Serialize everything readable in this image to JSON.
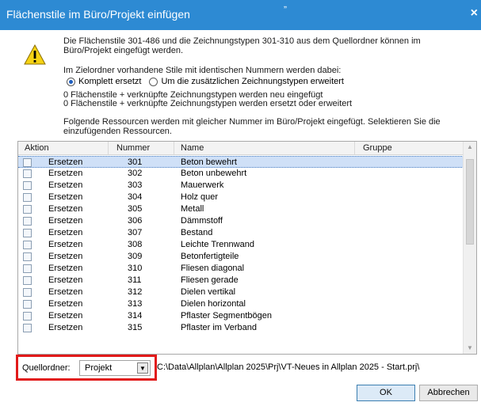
{
  "window": {
    "title": "Flächenstile im Büro/Projekt einfügen",
    "top_glyph": "„",
    "close_glyph": "×"
  },
  "message": {
    "line1": "Die Flächenstile 301-486 und die Zeichnungstypen 301-310 aus dem Quellordner können im Büro/Projekt eingefügt werden.",
    "line2": "Im Zielordner vorhandene Stile mit identischen Nummern werden dabei:",
    "radio_replace": "Komplett ersetzt",
    "radio_extend": "Um die zusätzlichen Zeichnungstypen erweitert",
    "line3": "0 Flächenstile + verknüpfte Zeichnungstypen werden neu eingefügt",
    "line4": "0 Flächenstile + verknüpfte Zeichnungstypen werden ersetzt oder erweitert",
    "line5": "Folgende Ressourcen werden mit gleicher Nummer im Büro/Projekt eingefügt. Selektieren Sie die einzufügenden Ressourcen."
  },
  "table": {
    "headers": {
      "action": "Aktion",
      "number": "Nummer",
      "name": "Name",
      "group": "Gruppe"
    },
    "rows": [
      {
        "action": "Ersetzen",
        "number": "301",
        "name": "Beton bewehrt",
        "selected": true
      },
      {
        "action": "Ersetzen",
        "number": "302",
        "name": "Beton unbewehrt"
      },
      {
        "action": "Ersetzen",
        "number": "303",
        "name": "Mauerwerk"
      },
      {
        "action": "Ersetzen",
        "number": "304",
        "name": "Holz quer"
      },
      {
        "action": "Ersetzen",
        "number": "305",
        "name": "Metall"
      },
      {
        "action": "Ersetzen",
        "number": "306",
        "name": "Dämmstoff"
      },
      {
        "action": "Ersetzen",
        "number": "307",
        "name": "Bestand"
      },
      {
        "action": "Ersetzen",
        "number": "308",
        "name": "Leichte Trennwand"
      },
      {
        "action": "Ersetzen",
        "number": "309",
        "name": "Betonfertigteile"
      },
      {
        "action": "Ersetzen",
        "number": "310",
        "name": "Fliesen diagonal"
      },
      {
        "action": "Ersetzen",
        "number": "311",
        "name": "Fliesen gerade"
      },
      {
        "action": "Ersetzen",
        "number": "312",
        "name": "Dielen vertikal"
      },
      {
        "action": "Ersetzen",
        "number": "313",
        "name": "Dielen horizontal"
      },
      {
        "action": "Ersetzen",
        "number": "314",
        "name": "Pflaster Segmentbögen"
      },
      {
        "action": "Ersetzen",
        "number": "315",
        "name": "Pflaster im Verband"
      }
    ]
  },
  "source": {
    "label": "Quellordner:",
    "selected": "Projekt",
    "path": "C:\\Data\\Allplan\\Allplan 2025\\Prj\\VT-Neues in Allplan 2025 - Start.prj\\"
  },
  "buttons": {
    "ok": "OK",
    "cancel": "Abbrechen"
  },
  "colors": {
    "titlebar": "#2d8ad3",
    "selection": "#cfe0f7",
    "highlight_frame": "#e11a1a",
    "warning_yellow": "#f5d214"
  },
  "icons": {
    "warning": "warning-icon",
    "close": "close-icon",
    "dropdown": "chevron-down-icon"
  }
}
